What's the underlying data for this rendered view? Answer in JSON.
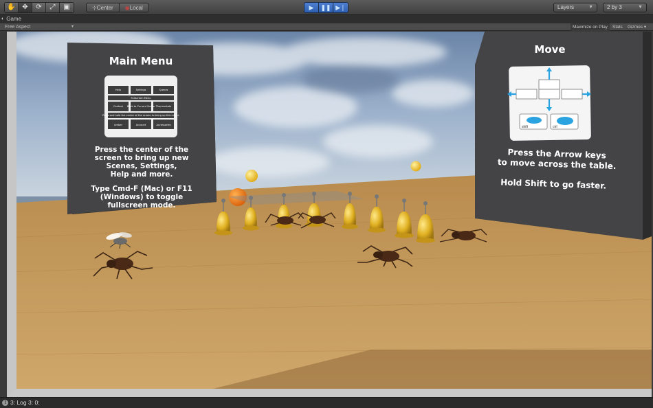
{
  "toolbar": {
    "transform_tools": [
      "hand-tool-icon",
      "move-tool-icon",
      "rotate-tool-icon",
      "scale-tool-icon",
      "rect-tool-icon"
    ],
    "pivot_center": "Center",
    "pivot_local": "Local",
    "play_controls": [
      "play-icon",
      "pause-icon",
      "step-icon"
    ],
    "layers_label": "Layers",
    "layout_label": "2 by 3",
    "accent_color": "#3a6fc9"
  },
  "window": {
    "tab_label": "Game"
  },
  "game_toolbar": {
    "aspect_label": "Free Aspect",
    "maximize_label": "Maximize on Play",
    "stats_label": "Stats",
    "gizmos_label": "Gizmos"
  },
  "scene": {
    "main_menu": {
      "title": "Main Menu",
      "grid_rows": [
        [
          "Help",
          "Settings",
          "Scenes"
        ],
        [
          "Fullscreen Menu"
        ],
        [
          "Contact",
          "Back to Current Scene",
          "Thermostats"
        ],
        [
          "Press and hold the center of the screen to bring up this menu."
        ],
        [
          "Amber",
          "Account",
          "Accessories"
        ]
      ],
      "instructions": [
        "Press the center of the",
        "screen to bring up new",
        "Scenes, Settings,",
        "Help and more."
      ],
      "fullscreen_hint": [
        "Type Cmd-F (Mac) or F11",
        "(Windows) to toggle",
        "fullscreen mode."
      ]
    },
    "move_panel": {
      "title": "Move",
      "shift_key": "shift",
      "ctrl_key": "ctrl",
      "instructions": [
        "Press the Arrow keys",
        "to move across the table."
      ],
      "speed_hint": "Hold Shift to go faster."
    }
  },
  "status": {
    "text": "3: Log 3: 0:"
  }
}
